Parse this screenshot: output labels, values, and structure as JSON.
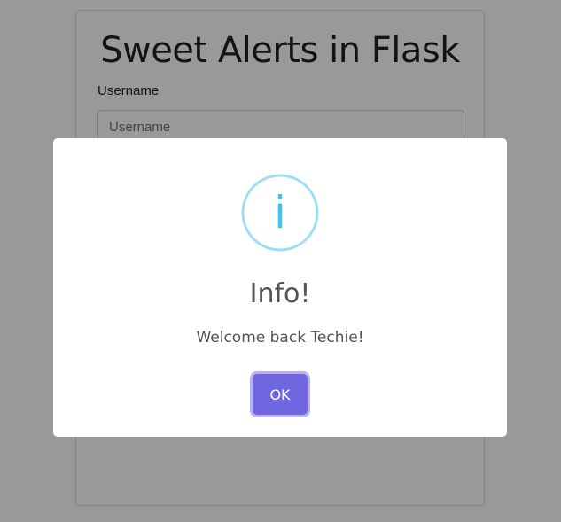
{
  "form": {
    "title": "Sweet Alerts in Flask",
    "username_label": "Username",
    "username_placeholder": "Username"
  },
  "alert": {
    "icon": "info-icon",
    "icon_glyph": "i",
    "icon_color": "#3fc3ee",
    "title": "Info!",
    "text": "Welcome back Techie!",
    "confirm_label": "OK",
    "confirm_color": "#7066e0"
  }
}
